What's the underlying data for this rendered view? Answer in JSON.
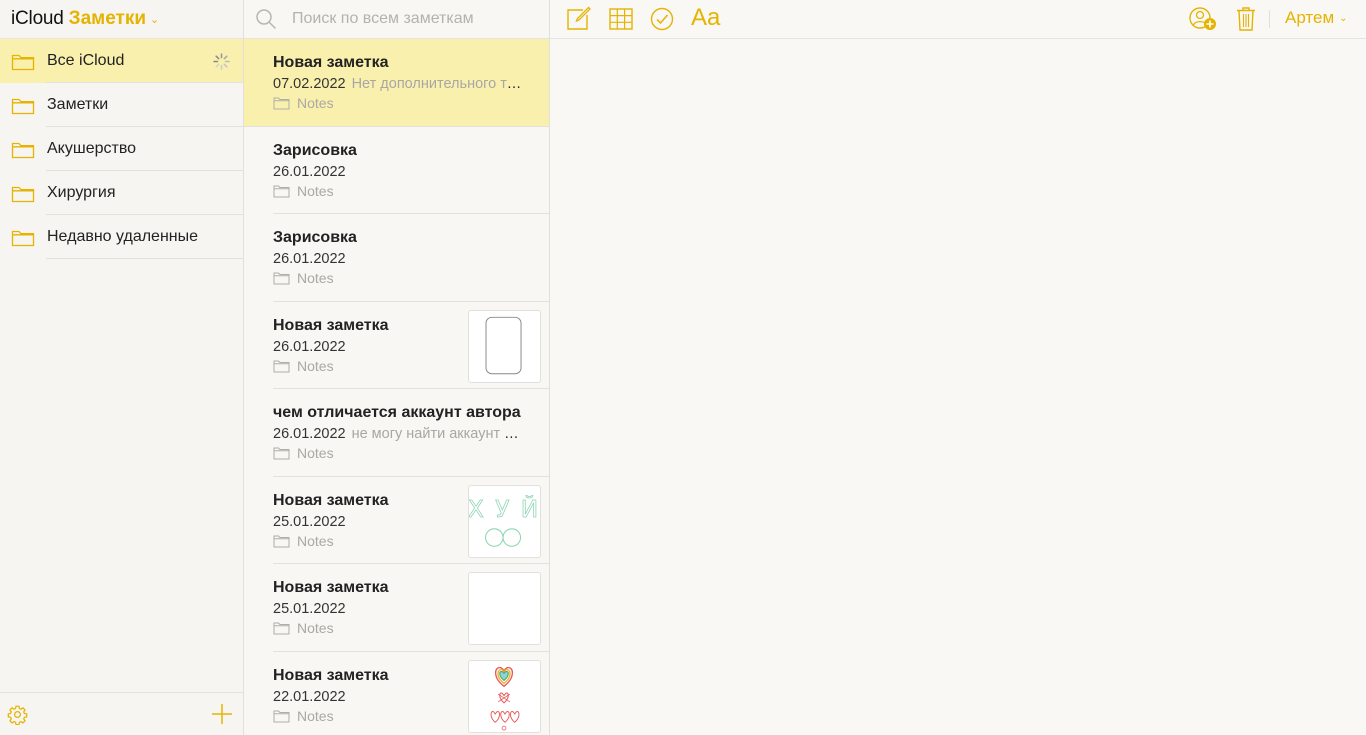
{
  "app": {
    "brand": "iCloud",
    "name": "Заметки"
  },
  "colors": {
    "accent": "#e5b300",
    "selected_row": "#faf0ae"
  },
  "sidebar": {
    "folders": [
      {
        "label": "Все iCloud",
        "icon": "folder-icon",
        "selected": true,
        "loading": true
      },
      {
        "label": "Заметки",
        "icon": "folder-icon"
      },
      {
        "label": "Акушерство",
        "icon": "folder-icon"
      },
      {
        "label": "Хирургия",
        "icon": "folder-icon"
      },
      {
        "label": "Недавно удаленные",
        "icon": "folder-icon"
      }
    ],
    "bottom_icons": [
      "gear-icon",
      "plus-icon"
    ]
  },
  "search": {
    "placeholder": "Поиск по всем заметкам",
    "value": ""
  },
  "notes": [
    {
      "title": "Новая заметка",
      "date": "07.02.2022",
      "snippet": "Нет дополнительного текста",
      "folder": "Notes",
      "selected": true
    },
    {
      "title": "Зарисовка",
      "date": "26.01.2022",
      "snippet": "",
      "folder": "Notes"
    },
    {
      "title": "Зарисовка",
      "date": "26.01.2022",
      "snippet": "",
      "folder": "Notes"
    },
    {
      "title": "Новая заметка",
      "date": "26.01.2022",
      "snippet": "",
      "folder": "Notes",
      "thumbnail": "phone-sketch"
    },
    {
      "title": "чем отличается аккаунт автора",
      "date": "26.01.2022",
      "snippet": "не могу найти аккаунт автора",
      "folder": "Notes"
    },
    {
      "title": "Новая заметка",
      "date": "25.01.2022",
      "snippet": "",
      "folder": "Notes",
      "thumbnail": "letters-sketch",
      "thumbnail_text": "Х У Й"
    },
    {
      "title": "Новая заметка",
      "date": "25.01.2022",
      "snippet": "",
      "folder": "Notes",
      "thumbnail": "blank"
    },
    {
      "title": "Новая заметка",
      "date": "22.01.2022",
      "snippet": "",
      "folder": "Notes",
      "thumbnail": "hearts-sketch"
    }
  ],
  "toolbar": {
    "icons": [
      "compose-icon",
      "table-icon",
      "checklist-icon",
      "format-icon",
      "share-people-icon",
      "trash-icon"
    ],
    "format_label": "Aa",
    "user_name": "Артем"
  }
}
